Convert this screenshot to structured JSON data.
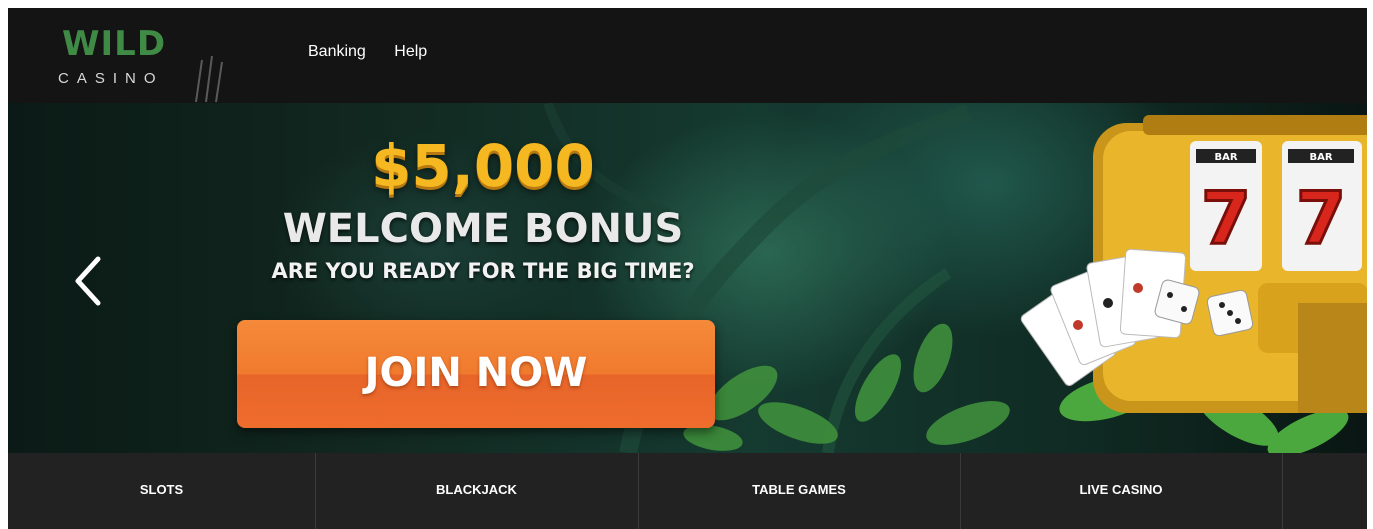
{
  "brand": {
    "logo_primary": "WILD",
    "logo_secondary": "CASINO",
    "accent_color": "#3f8a45"
  },
  "nav": {
    "links": [
      "Banking",
      "Help"
    ]
  },
  "hero": {
    "amount": "$5,000",
    "headline": "WELCOME BONUS",
    "tagline": "ARE YOU READY FOR THE BIG TIME?",
    "cta_label": "JOIN NOW",
    "cta_color": "#f07a2e",
    "amount_color": "#f5b820",
    "slot_reel_symbols": [
      "BAR",
      "BAR",
      "7",
      "7"
    ],
    "prev_arrow_icon": "chevron-left-icon"
  },
  "categories": [
    "SLOTS",
    "BLACKJACK",
    "TABLE GAMES",
    "LIVE CASINO"
  ]
}
